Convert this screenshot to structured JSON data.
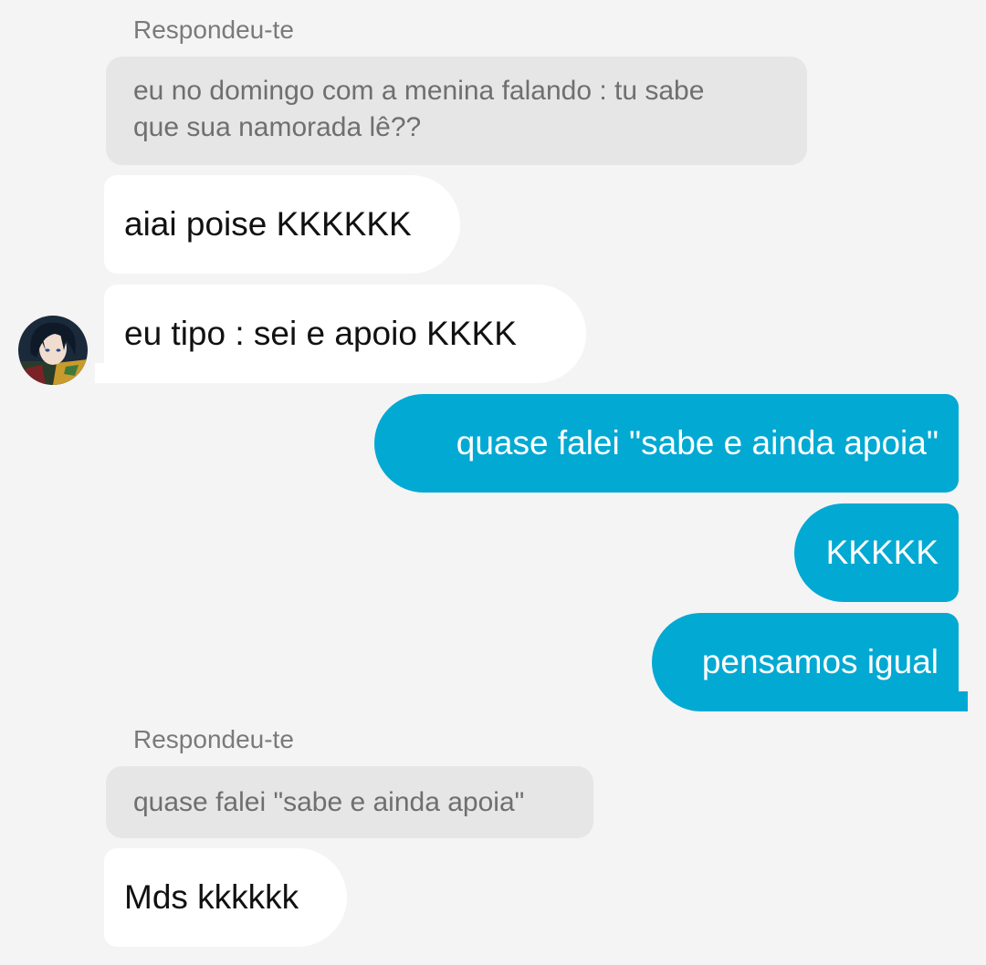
{
  "thread": {
    "reply_label_1": "Respondeu-te",
    "quote_1_line_1": "eu no domingo com a menina falando : tu sabe",
    "quote_1_line_2": "que sua namorada lê??",
    "msg_1": "aiai poise KKKKKK",
    "msg_2": "eu tipo : sei e apoio KKKK",
    "msg_3": "quase falei \"sabe e ainda apoia\"",
    "msg_4": "KKKKK",
    "msg_5": "pensamos igual",
    "reply_label_2": "Respondeu-te",
    "quote_2": "quase falei \"sabe e ainda apoia\"",
    "msg_6": "Mds kkkkkk"
  },
  "colors": {
    "background": "#f4f4f4",
    "incoming_bubble": "#ffffff",
    "outgoing_bubble": "#02a9d3",
    "quote_bubble": "#e6e6e6"
  },
  "icons": {
    "avatar": "anime-avatar"
  }
}
